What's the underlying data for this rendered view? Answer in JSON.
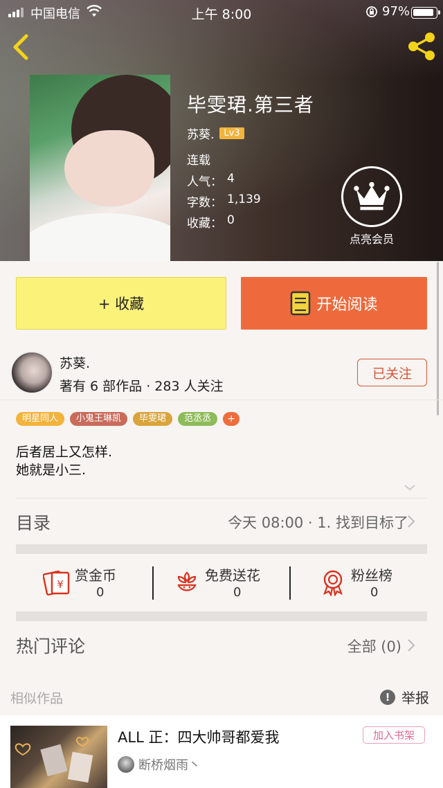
{
  "status_bar": {
    "carrier": "中国电信",
    "time": "上午 8:00",
    "battery_percent": "97%"
  },
  "book": {
    "title": "毕雯珺.第三者",
    "author": "苏葵.",
    "level": "Lv3",
    "status": "连载",
    "stats": [
      {
        "key": "人气：",
        "value": "4"
      },
      {
        "key": "字数：",
        "value": "1,139"
      },
      {
        "key": "收藏：",
        "value": "0"
      }
    ],
    "vip_label": "点亮会员"
  },
  "actions": {
    "collect_label": "+ 收藏",
    "read_label": "开始阅读"
  },
  "author_card": {
    "name": "苏葵.",
    "stats_text": "著有 6 部作品 · 283 人关注",
    "follow_label": "已关注"
  },
  "tags": [
    {
      "label": "明星同人",
      "color": "#f3b33d"
    },
    {
      "label": "小鬼王琳凯",
      "color": "#c96b5b"
    },
    {
      "label": "毕雯珺",
      "color": "#d9a43c"
    },
    {
      "label": "范丞丞",
      "color": "#8dbb5a"
    }
  ],
  "tag_add": "+",
  "synopsis": {
    "line1": "后者居上又怎样.",
    "line2": "她就是小三."
  },
  "toc": {
    "title": "目录",
    "latest": "今天 08:00 · 1. 找到目标了"
  },
  "rewards": [
    {
      "label": "赏金币",
      "value": "0",
      "icon": "red-envelope-icon"
    },
    {
      "label": "免费送花",
      "value": "0",
      "icon": "flower-icon"
    },
    {
      "label": "粉丝榜",
      "value": "0",
      "icon": "medal-icon"
    }
  ],
  "comments": {
    "title": "热门评论",
    "all_label": "全部 (0)"
  },
  "similar": {
    "title": "相似作品",
    "report_label": "举报",
    "item": {
      "title": "ALL 正：四大帅哥都爱我",
      "add_label": "加入书架",
      "author": "断桥烟雨丶"
    }
  },
  "colors": {
    "accent_orange": "#ee6a3c",
    "collect_yellow": "#fbf27a",
    "gold": "#f1b43e",
    "icon_red": "#d9321f"
  }
}
